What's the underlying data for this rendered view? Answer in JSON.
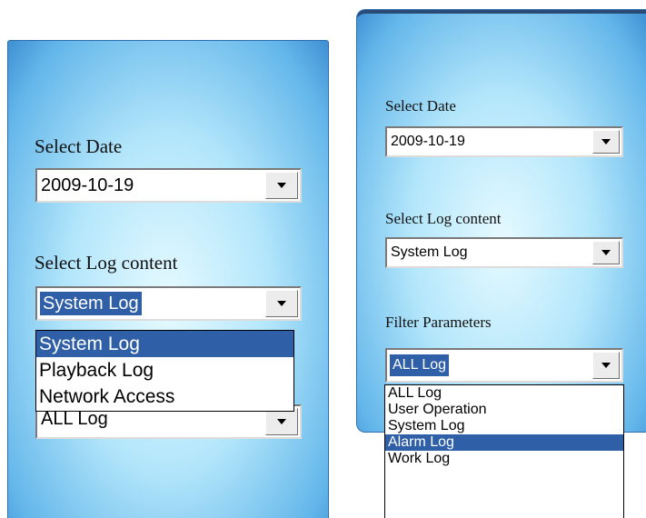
{
  "left_panel": {
    "select_date_label": "Select Date",
    "date_value": "2009-10-19",
    "log_content_label": "Select Log content",
    "log_content_value": "System Log",
    "log_content_options": [
      "System Log",
      "Playback Log",
      "Network Access"
    ],
    "filter_value": "ALL Log"
  },
  "right_panel": {
    "select_date_label": "Select Date",
    "date_value": "2009-10-19",
    "log_content_label": "Select Log content",
    "log_content_value": "System Log",
    "filter_label": "Filter Parameters",
    "filter_value": "ALL Log",
    "filter_options": [
      "ALL Log",
      "User Operation",
      "System Log",
      "Alarm Log",
      "Work Log"
    ]
  },
  "colors": {
    "selection_highlight": "#2f5fa6",
    "panel_border": "#2f6db0"
  }
}
